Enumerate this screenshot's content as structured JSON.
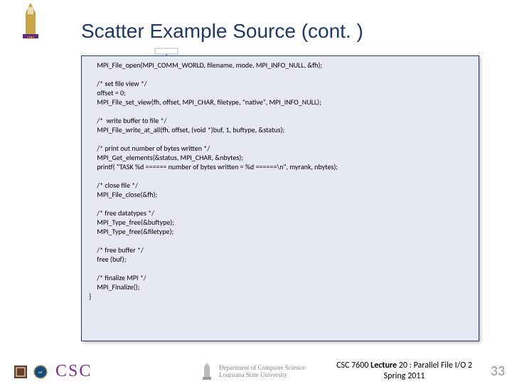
{
  "title": "Scatter Example Source (cont. )",
  "code": "     MPI_File_open(MPI_COMM_WORLD, filename, mode, MPI_INFO_NULL, &fh);\n\n     /* set file view */\n     offset = 0;\n     MPI_File_set_view(fh, offset, MPI_CHAR, filetype, \"native\", MPI_INFO_NULL);\n\n     /*  write buffer to file */\n     MPI_File_write_at_all(fh, offset, (void *)buf, 1, buftype, &status);\n\n     /* print out number of bytes written */\n     MPI_Get_elements(&status, MPI_CHAR, &nbytes);\n     printf( \"TASK %d ====== number of bytes written = %d ======\\n\", myrank, nbytes);\n\n     /* close file */\n     MPI_File_close(&fh);\n\n     /* free datatypes */\n     MPI_Type_free(&buftype);\n     MPI_Type_free(&filetype);\n\n     /* free buffer */\n     free (buf);\n\n     /* finalize MPI */\n     MPI_Finalize();\n}",
  "footer": {
    "csc": "CSC",
    "dept_line1": "Department of Computer Science",
    "dept_line2": "Louisiana State University",
    "course_line1_a": "CSC 7600 ",
    "course_line1_b": "Lecture",
    "course_line1_c": " 20 : Parallel File I/O 2",
    "course_line2": "Spring 2011",
    "slide_num": "33"
  }
}
